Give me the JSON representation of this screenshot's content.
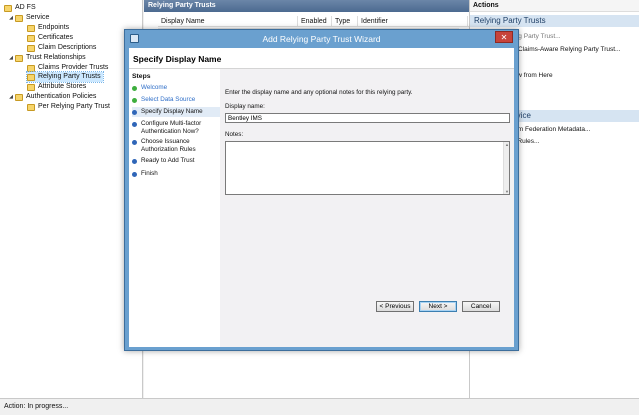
{
  "tree": {
    "items": [
      {
        "label": "AD FS",
        "level": 0,
        "icon": "folder"
      },
      {
        "label": "Service",
        "level": 1,
        "icon": "folder",
        "expanded": true
      },
      {
        "label": "Endpoints",
        "level": 2,
        "icon": "folder"
      },
      {
        "label": "Certificates",
        "level": 2,
        "icon": "folder"
      },
      {
        "label": "Claim Descriptions",
        "level": 2,
        "icon": "folder"
      },
      {
        "label": "Trust Relationships",
        "level": 1,
        "icon": "folder",
        "expanded": true
      },
      {
        "label": "Claims Provider Trusts",
        "level": 2,
        "icon": "folder"
      },
      {
        "label": "Relying Party Trusts",
        "level": 2,
        "icon": "folder",
        "selected": true
      },
      {
        "label": "Attribute Stores",
        "level": 2,
        "icon": "folder"
      },
      {
        "label": "Authentication Policies",
        "level": 1,
        "icon": "folder",
        "expanded": true
      },
      {
        "label": "Per Relying Party Trust",
        "level": 2,
        "icon": "folder"
      }
    ]
  },
  "center": {
    "header": "Relying Party Trusts",
    "columns": [
      "Display Name",
      "Enabled",
      "Type",
      "Identifier"
    ]
  },
  "actions": {
    "header": "Actions",
    "section1": "Relying Party Trusts",
    "items1": [
      "ying Party Trust...",
      "Claims-Aware Relying Party Trust...",
      "dow from Here"
    ],
    "section2": "istration Service",
    "items2": [
      "rom Federation Metadata...",
      "n Rules..."
    ]
  },
  "status": {
    "text": "Action:  In progress..."
  },
  "wizard": {
    "title": "Add Relying Party Trust Wizard",
    "close_glyph": "✕",
    "page_title": "Specify Display Name",
    "steps_heading": "Steps",
    "steps": [
      {
        "label": "Welcome",
        "state": "done"
      },
      {
        "label": "Select Data Source",
        "state": "done"
      },
      {
        "label": "Specify Display Name",
        "state": "current"
      },
      {
        "label": "Configure Multi-factor Authentication Now?",
        "state": "todo"
      },
      {
        "label": "Choose Issuance Authorization Rules",
        "state": "todo"
      },
      {
        "label": "Ready to Add Trust",
        "state": "todo"
      },
      {
        "label": "Finish",
        "state": "todo"
      }
    ],
    "intro": "Enter the display name and any optional notes for this relying party.",
    "display_name_label": "Display name:",
    "display_name_value": "Bentley IMS",
    "notes_label": "Notes:",
    "notes_value": "",
    "buttons": {
      "previous": "< Previous",
      "next": "Next >",
      "cancel": "Cancel"
    }
  },
  "colors": {
    "step_done": "#3eae3e",
    "step_pending": "#2f66b8",
    "title_bar": "#6aa0cf",
    "close": "#c7433a"
  }
}
